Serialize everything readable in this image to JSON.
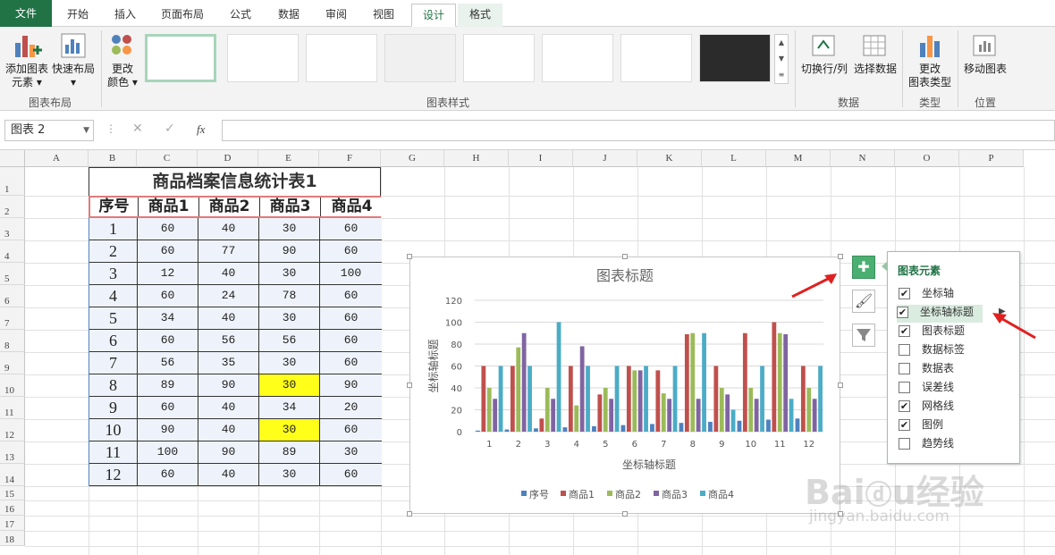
{
  "tabs": [
    "文件",
    "开始",
    "插入",
    "页面布局",
    "公式",
    "数据",
    "审阅",
    "视图",
    "设计",
    "格式"
  ],
  "ribbon": {
    "add_element": [
      "添加图表",
      "元素 ▾"
    ],
    "quick_layout": [
      "快速布局",
      "▾"
    ],
    "change_color": [
      "更改",
      "颜色 ▾"
    ],
    "group_layout": "图表布局",
    "group_styles": "图表样式",
    "switch_rowcol": "切换行/列",
    "select_data": "选择数据",
    "group_data": "数据",
    "change_type": [
      "更改",
      "图表类型"
    ],
    "group_type": "类型",
    "move_chart": "移动图表",
    "group_location": "位置"
  },
  "formula_bar": {
    "name_box": "图表 2",
    "fx": "fx"
  },
  "columns": [
    "A",
    "B",
    "C",
    "D",
    "E",
    "F",
    "G",
    "H",
    "I",
    "J",
    "K",
    "L",
    "M",
    "N",
    "O",
    "P"
  ],
  "rows": [
    "1",
    "2",
    "3",
    "4",
    "5",
    "6",
    "7",
    "8",
    "9",
    "10",
    "11",
    "12",
    "13",
    "14",
    "15",
    "16",
    "17",
    "18"
  ],
  "table": {
    "title": "商品档案信息统计表1",
    "headers": [
      "序号",
      "商品1",
      "商品2",
      "商品3",
      "商品4"
    ],
    "data": [
      [
        "1",
        "60",
        "40",
        "30",
        "60"
      ],
      [
        "2",
        "60",
        "77",
        "90",
        "60"
      ],
      [
        "3",
        "12",
        "40",
        "30",
        "100"
      ],
      [
        "4",
        "60",
        "24",
        "78",
        "60"
      ],
      [
        "5",
        "34",
        "40",
        "30",
        "60"
      ],
      [
        "6",
        "60",
        "56",
        "56",
        "60"
      ],
      [
        "7",
        "56",
        "35",
        "30",
        "60"
      ],
      [
        "8",
        "89",
        "90",
        "30",
        "90"
      ],
      [
        "9",
        "60",
        "40",
        "34",
        "20"
      ],
      [
        "10",
        "90",
        "40",
        "30",
        "60"
      ],
      [
        "11",
        "100",
        "90",
        "89",
        "30"
      ],
      [
        "12",
        "60",
        "40",
        "30",
        "60"
      ]
    ]
  },
  "chart_data": {
    "type": "bar",
    "title": "图表标题",
    "xlabel": "坐标轴标题",
    "ylabel": "坐标轴标题",
    "ylim": [
      0,
      120
    ],
    "yticks": [
      "0",
      "20",
      "40",
      "60",
      "80",
      "100",
      "120"
    ],
    "categories": [
      "1",
      "2",
      "3",
      "4",
      "5",
      "6",
      "7",
      "8",
      "9",
      "10",
      "11",
      "12"
    ],
    "series": [
      {
        "name": "序号",
        "color": "#4f81bd",
        "values": [
          1,
          2,
          3,
          4,
          5,
          6,
          7,
          8,
          9,
          10,
          11,
          12
        ]
      },
      {
        "name": "商品1",
        "color": "#c0504d",
        "values": [
          60,
          60,
          12,
          60,
          34,
          60,
          56,
          89,
          60,
          90,
          100,
          60
        ]
      },
      {
        "name": "商品2",
        "color": "#9bbb59",
        "values": [
          40,
          77,
          40,
          24,
          40,
          56,
          35,
          90,
          40,
          40,
          90,
          40
        ]
      },
      {
        "name": "商品3",
        "color": "#8064a2",
        "values": [
          30,
          90,
          30,
          78,
          30,
          56,
          30,
          30,
          34,
          30,
          89,
          30
        ]
      },
      {
        "name": "商品4",
        "color": "#4bacc6",
        "values": [
          60,
          60,
          100,
          60,
          60,
          60,
          60,
          90,
          20,
          60,
          30,
          60
        ]
      }
    ],
    "legend": "bottom",
    "grid": true
  },
  "panel": {
    "title": "图表元素",
    "items": [
      {
        "label": "坐标轴",
        "checked": true
      },
      {
        "label": "坐标轴标题",
        "checked": true
      },
      {
        "label": "图表标题",
        "checked": true
      },
      {
        "label": "数据标签",
        "checked": false
      },
      {
        "label": "数据表",
        "checked": false
      },
      {
        "label": "误差线",
        "checked": false
      },
      {
        "label": "网格线",
        "checked": true
      },
      {
        "label": "图例",
        "checked": true
      },
      {
        "label": "趋势线",
        "checked": false
      }
    ]
  },
  "watermark": "Baidu经验 jingyan.baidu.com"
}
